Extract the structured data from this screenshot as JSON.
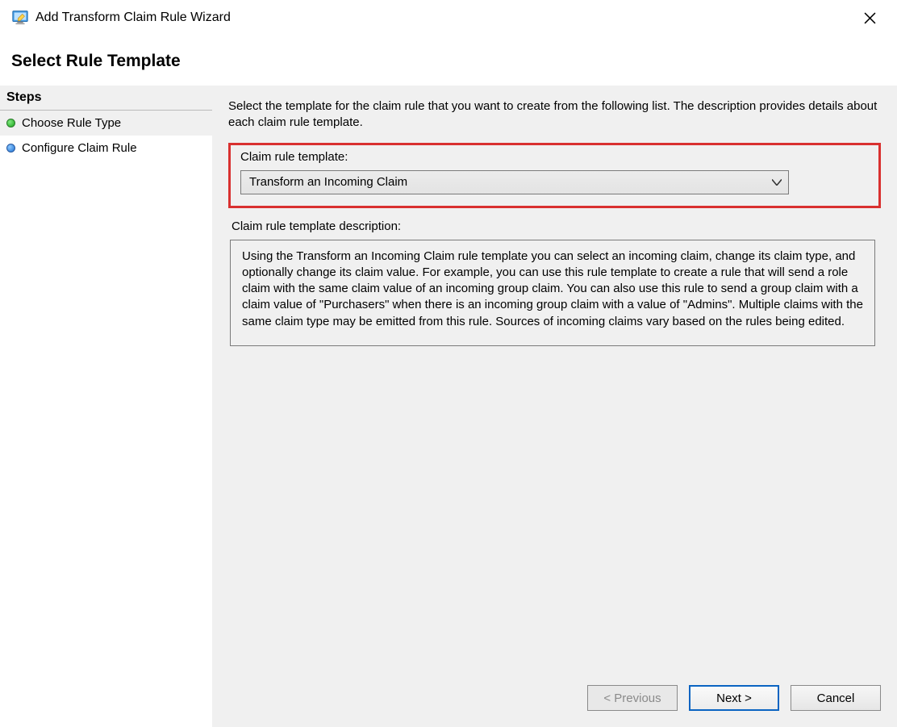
{
  "window": {
    "title": "Add Transform Claim Rule Wizard"
  },
  "header": {
    "title": "Select Rule Template"
  },
  "sidebar": {
    "steps_label": "Steps",
    "items": [
      {
        "label": "Choose Rule Type"
      },
      {
        "label": "Configure Claim Rule"
      }
    ]
  },
  "main": {
    "intro": "Select the template for the claim rule that you want to create from the following list. The description provides details about each claim rule template.",
    "template_label": "Claim rule template:",
    "template_selected": "Transform an Incoming Claim",
    "description_label": "Claim rule template description:",
    "description_text": "Using the Transform an Incoming Claim rule template you can select an incoming claim, change its claim type, and optionally change its claim value.  For example, you can use this rule template to create a rule that will send a role claim with the same claim value of an incoming group claim.  You can also use this rule to send a group claim with a claim value of \"Purchasers\" when there is an incoming group claim with a value of \"Admins\".  Multiple claims with the same claim type may be emitted from this rule.  Sources of incoming claims vary based on the rules being edited."
  },
  "footer": {
    "previous_label": "< Previous",
    "next_label": "Next >",
    "cancel_label": "Cancel"
  }
}
